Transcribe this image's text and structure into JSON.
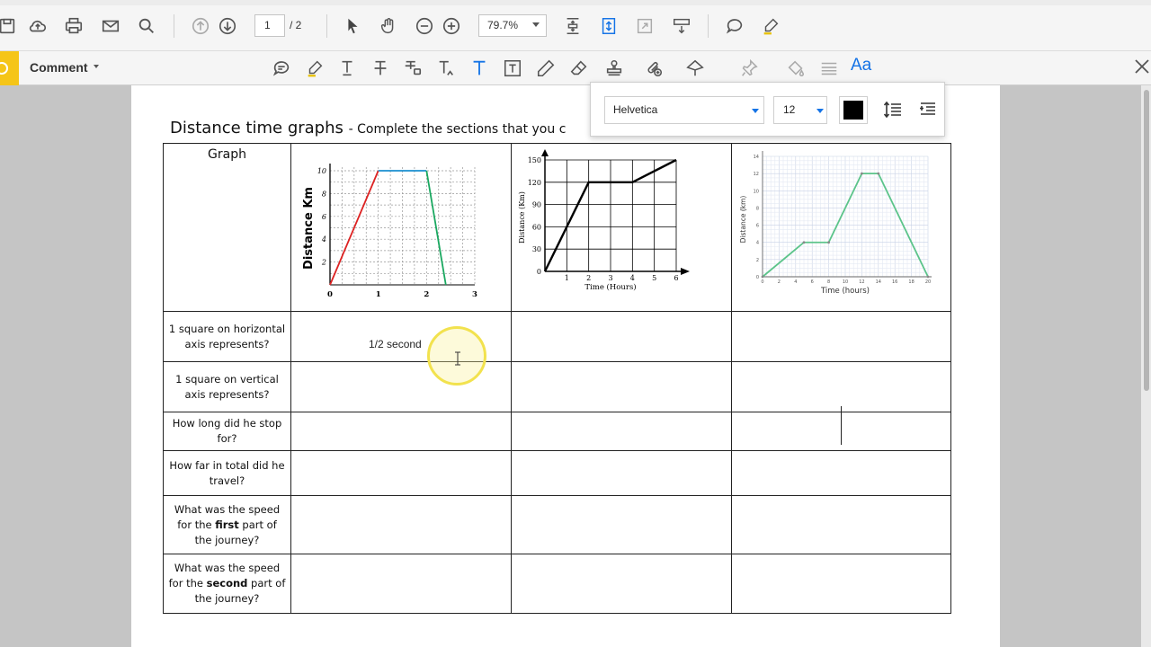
{
  "toolbar": {
    "page_current": "1",
    "page_total": "/ 2",
    "zoom": "79.7%"
  },
  "comment_bar": {
    "label": "Comment",
    "text_style_label": "Aa"
  },
  "font_panel": {
    "font_name": "Helvetica",
    "font_size": "12",
    "color": "#000000"
  },
  "document": {
    "title": "Distance time graphs",
    "subtitle": "- Complete the sections that you c",
    "graph_header": "Graph",
    "rows": [
      {
        "label": "1 square on horizontal axis represents?"
      },
      {
        "label": "1 square on vertical axis represents?"
      },
      {
        "label": "How long did he stop for?"
      },
      {
        "label": "How far in total did he travel?"
      },
      {
        "label_a": "What was the speed for the ",
        "label_b": "first",
        "label_c": " part of the journey?"
      },
      {
        "label_a": "What was the speed for the ",
        "label_b": "second",
        "label_c": " part of the journey?"
      }
    ],
    "typed_answer": "1/2 second"
  },
  "graphs": {
    "g1": {
      "ylabel": "Distance Km",
      "yticks": [
        "10",
        "8",
        "6",
        "4",
        "2"
      ],
      "xticks": [
        "0",
        "1",
        "2",
        "3"
      ]
    },
    "g2": {
      "ylabel": "Distance (Km)",
      "xlabel": "Time (Hours)",
      "yticks": [
        "150",
        "120",
        "90",
        "60",
        "30",
        "0"
      ],
      "xticks": [
        "1",
        "2",
        "3",
        "4",
        "5",
        "6"
      ]
    },
    "g3": {
      "ylabel": "Distance (km)",
      "xlabel": "Time (hours)",
      "yticks": [
        "14",
        "12",
        "10",
        "8",
        "6",
        "4",
        "2",
        "0"
      ],
      "xticks": [
        "0",
        "2",
        "4",
        "6",
        "8",
        "10",
        "12",
        "14",
        "16",
        "18",
        "20"
      ]
    }
  },
  "chart_data": [
    {
      "type": "line",
      "ylabel": "Distance Km",
      "x": [
        0,
        1,
        2,
        2.4
      ],
      "y": [
        0,
        10,
        10,
        0
      ],
      "xlim": [
        0,
        3
      ],
      "ylim": [
        0,
        10
      ]
    },
    {
      "type": "line",
      "xlabel": "Time (Hours)",
      "ylabel": "Distance (Km)",
      "x": [
        0,
        2,
        4,
        6
      ],
      "y": [
        0,
        120,
        120,
        150
      ],
      "xlim": [
        0,
        6
      ],
      "ylim": [
        0,
        150
      ]
    },
    {
      "type": "line",
      "xlabel": "Time (hours)",
      "ylabel": "Distance (km)",
      "x": [
        0,
        5,
        8,
        12,
        14,
        20
      ],
      "y": [
        0,
        4,
        4,
        12,
        12,
        0
      ],
      "xlim": [
        0,
        20
      ],
      "ylim": [
        0,
        14
      ]
    }
  ]
}
